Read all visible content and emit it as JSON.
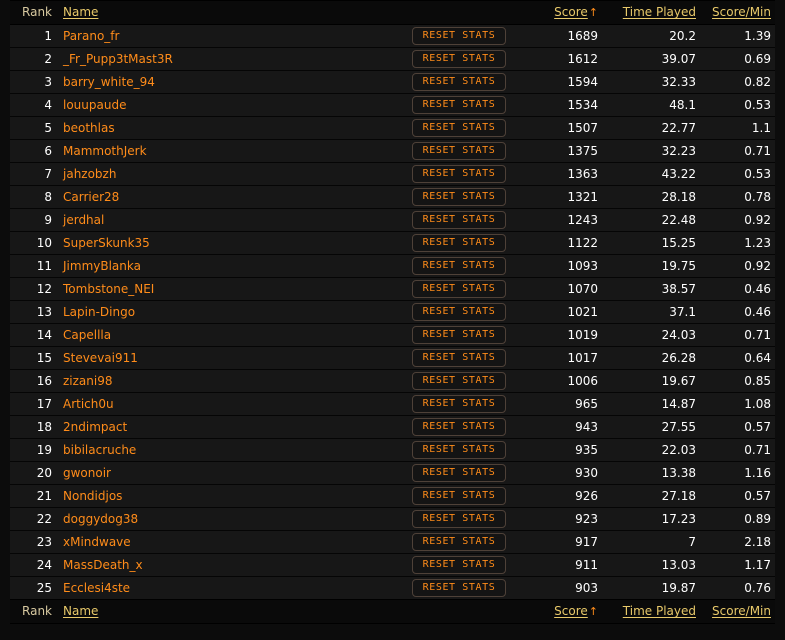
{
  "table": {
    "columns": {
      "rank": "Rank",
      "name": "Name",
      "score": "Score",
      "sort_indicator": "↑",
      "time_played": "Time Played",
      "score_per_min": "Score/Min"
    },
    "reset_button_label": "RESET STATS",
    "colors": {
      "page_background": "#0c0c0c",
      "row_background": "#171717",
      "header_background": "#0a0a0a",
      "column_header_text": "#e8c96a",
      "rank_header_text": "#d8c9a0",
      "player_name_text": "#ff8c1a",
      "value_text": "#ffffff",
      "button_border": "#4e4138",
      "button_text": "#ff8c1a"
    },
    "rows": [
      {
        "rank": "1",
        "name": "Parano_fr",
        "score": "1689",
        "time_played": "20.2",
        "score_per_min": "1.39"
      },
      {
        "rank": "2",
        "name": "_Fr_Pupp3tMast3R",
        "score": "1612",
        "time_played": "39.07",
        "score_per_min": "0.69"
      },
      {
        "rank": "3",
        "name": "barry_white_94",
        "score": "1594",
        "time_played": "32.33",
        "score_per_min": "0.82"
      },
      {
        "rank": "4",
        "name": "louupaude",
        "score": "1534",
        "time_played": "48.1",
        "score_per_min": "0.53"
      },
      {
        "rank": "5",
        "name": "beothlas",
        "score": "1507",
        "time_played": "22.77",
        "score_per_min": "1.1"
      },
      {
        "rank": "6",
        "name": "MammothJerk",
        "score": "1375",
        "time_played": "32.23",
        "score_per_min": "0.71"
      },
      {
        "rank": "7",
        "name": "jahzobzh",
        "score": "1363",
        "time_played": "43.22",
        "score_per_min": "0.53"
      },
      {
        "rank": "8",
        "name": "Carrier28",
        "score": "1321",
        "time_played": "28.18",
        "score_per_min": "0.78"
      },
      {
        "rank": "9",
        "name": "jerdhal",
        "score": "1243",
        "time_played": "22.48",
        "score_per_min": "0.92"
      },
      {
        "rank": "10",
        "name": "SuperSkunk35",
        "score": "1122",
        "time_played": "15.25",
        "score_per_min": "1.23"
      },
      {
        "rank": "11",
        "name": "JimmyBlanka",
        "score": "1093",
        "time_played": "19.75",
        "score_per_min": "0.92"
      },
      {
        "rank": "12",
        "name": "Tombstone_NEI",
        "score": "1070",
        "time_played": "38.57",
        "score_per_min": "0.46"
      },
      {
        "rank": "13",
        "name": "Lapin-Dingo",
        "score": "1021",
        "time_played": "37.1",
        "score_per_min": "0.46"
      },
      {
        "rank": "14",
        "name": "Capellla",
        "score": "1019",
        "time_played": "24.03",
        "score_per_min": "0.71"
      },
      {
        "rank": "15",
        "name": "Stevevai911",
        "score": "1017",
        "time_played": "26.28",
        "score_per_min": "0.64"
      },
      {
        "rank": "16",
        "name": "zizani98",
        "score": "1006",
        "time_played": "19.67",
        "score_per_min": "0.85"
      },
      {
        "rank": "17",
        "name": "Artich0u",
        "score": "965",
        "time_played": "14.87",
        "score_per_min": "1.08"
      },
      {
        "rank": "18",
        "name": "2ndimpact",
        "score": "943",
        "time_played": "27.55",
        "score_per_min": "0.57"
      },
      {
        "rank": "19",
        "name": "bibilacruche",
        "score": "935",
        "time_played": "22.03",
        "score_per_min": "0.71"
      },
      {
        "rank": "20",
        "name": "gwonoir",
        "score": "930",
        "time_played": "13.38",
        "score_per_min": "1.16"
      },
      {
        "rank": "21",
        "name": "Nondidjos",
        "score": "926",
        "time_played": "27.18",
        "score_per_min": "0.57"
      },
      {
        "rank": "22",
        "name": "doggydog38",
        "score": "923",
        "time_played": "17.23",
        "score_per_min": "0.89"
      },
      {
        "rank": "23",
        "name": "xMindwave",
        "score": "917",
        "time_played": "7",
        "score_per_min": "2.18"
      },
      {
        "rank": "24",
        "name": "MassDeath_x",
        "score": "911",
        "time_played": "13.03",
        "score_per_min": "1.17"
      },
      {
        "rank": "25",
        "name": "Ecclesi4ste",
        "score": "903",
        "time_played": "19.87",
        "score_per_min": "0.76"
      }
    ]
  }
}
